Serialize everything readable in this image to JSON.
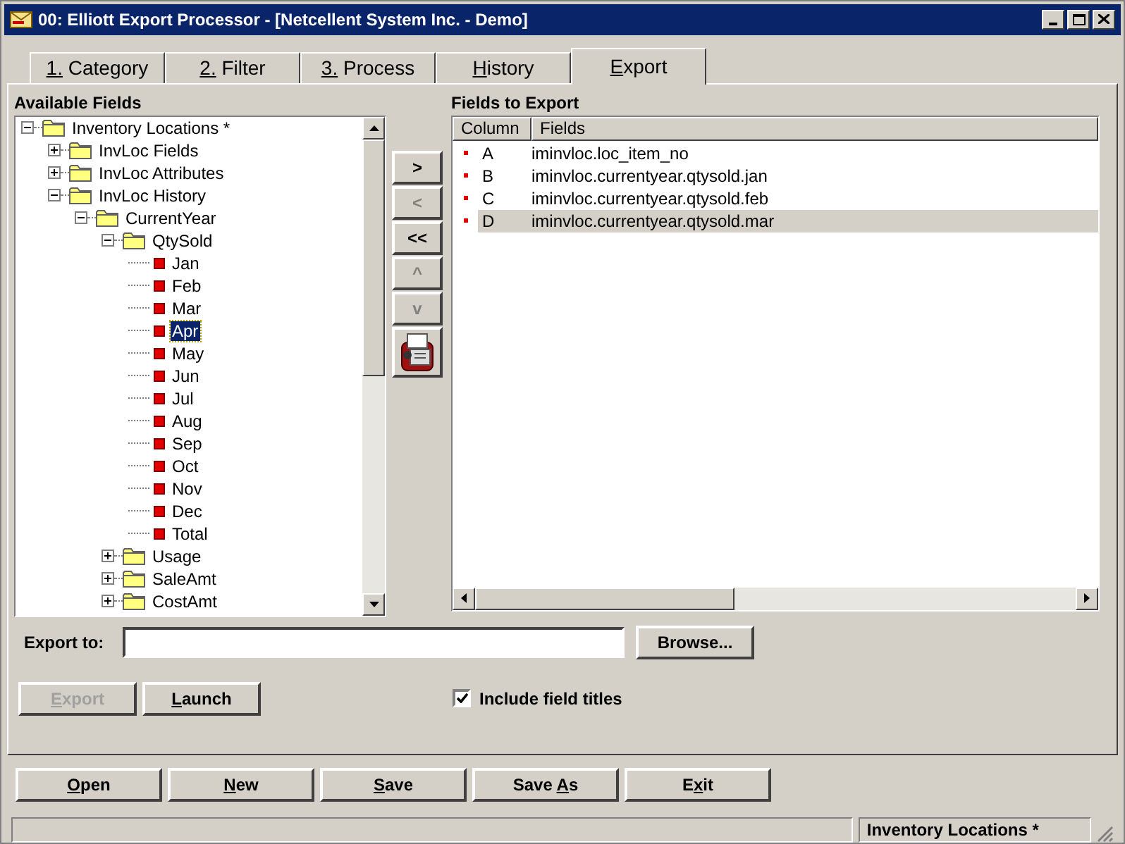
{
  "window": {
    "title": "00: Elliott Export Processor - [Netcellent System Inc. - Demo]"
  },
  "tabs": [
    {
      "key": "1.",
      "post": " Category",
      "selected": false
    },
    {
      "key": "2.",
      "post": " Filter",
      "selected": false
    },
    {
      "key": "3.",
      "post": " Process",
      "selected": false
    },
    {
      "key": "H",
      "post": "istory",
      "selected": false
    },
    {
      "key": "E",
      "post": "xport",
      "selected": true
    }
  ],
  "available_fields": {
    "title": "Available Fields",
    "tree": [
      {
        "kind": "folder",
        "label": "Inventory Locations *",
        "expanded": true,
        "selected": false,
        "children": [
          {
            "kind": "folder",
            "label": "InvLoc Fields",
            "expanded": false,
            "selected": false
          },
          {
            "kind": "folder",
            "label": "InvLoc Attributes",
            "expanded": false,
            "selected": false
          },
          {
            "kind": "folder",
            "label": "InvLoc History",
            "expanded": true,
            "selected": false,
            "children": [
              {
                "kind": "folder",
                "label": "CurrentYear",
                "expanded": true,
                "selected": false,
                "children": [
                  {
                    "kind": "folder",
                    "label": "QtySold",
                    "expanded": true,
                    "selected": false,
                    "children": [
                      {
                        "kind": "field",
                        "label": "Jan",
                        "selected": false
                      },
                      {
                        "kind": "field",
                        "label": "Feb",
                        "selected": false
                      },
                      {
                        "kind": "field",
                        "label": "Mar",
                        "selected": false
                      },
                      {
                        "kind": "field",
                        "label": "Apr",
                        "selected": true
                      },
                      {
                        "kind": "field",
                        "label": "May",
                        "selected": false
                      },
                      {
                        "kind": "field",
                        "label": "Jun",
                        "selected": false
                      },
                      {
                        "kind": "field",
                        "label": "Jul",
                        "selected": false
                      },
                      {
                        "kind": "field",
                        "label": "Aug",
                        "selected": false
                      },
                      {
                        "kind": "field",
                        "label": "Sep",
                        "selected": false
                      },
                      {
                        "kind": "field",
                        "label": "Oct",
                        "selected": false
                      },
                      {
                        "kind": "field",
                        "label": "Nov",
                        "selected": false
                      },
                      {
                        "kind": "field",
                        "label": "Dec",
                        "selected": false
                      },
                      {
                        "kind": "field",
                        "label": "Total",
                        "selected": false
                      }
                    ]
                  },
                  {
                    "kind": "folder",
                    "label": "Usage",
                    "expanded": false,
                    "selected": false
                  },
                  {
                    "kind": "folder",
                    "label": "SaleAmt",
                    "expanded": false,
                    "selected": false
                  },
                  {
                    "kind": "folder",
                    "label": "CostAmt",
                    "expanded": false,
                    "selected": false
                  }
                ]
              }
            ]
          }
        ]
      }
    ]
  },
  "move_buttons": [
    {
      "kind": "text",
      "label": ">",
      "disabled": false
    },
    {
      "kind": "text",
      "label": "<",
      "disabled": true
    },
    {
      "kind": "text",
      "label": "<<",
      "disabled": false
    },
    {
      "kind": "text",
      "label": "^",
      "disabled": true
    },
    {
      "kind": "text",
      "label": "v",
      "disabled": true
    },
    {
      "kind": "icon"
    }
  ],
  "fields_to_export": {
    "title": "Fields to Export",
    "columns": [
      "Column",
      "Fields"
    ],
    "rows": [
      {
        "column": "A",
        "field": "iminvloc.loc_item_no",
        "selected": false
      },
      {
        "column": "B",
        "field": "iminvloc.currentyear.qtysold.jan",
        "selected": false
      },
      {
        "column": "C",
        "field": "iminvloc.currentyear.qtysold.feb",
        "selected": false
      },
      {
        "column": "D",
        "field": "iminvloc.currentyear.qtysold.mar",
        "selected": true
      }
    ]
  },
  "export_to": {
    "label": "Export to:",
    "browse": "Browse..."
  },
  "actions": [
    {
      "key": "E",
      "post": "xport",
      "disabled": true
    },
    {
      "key": "L",
      "post": "aunch",
      "disabled": false
    }
  ],
  "include_field_titles": {
    "label": "Include field titles",
    "checked": true
  },
  "bottom_buttons": [
    {
      "key": "O",
      "post": "pen"
    },
    {
      "key": "N",
      "post": "ew"
    },
    {
      "key": "S",
      "post": "ave"
    },
    {
      "pre": "Save ",
      "key": "A",
      "post": "s"
    },
    {
      "pre": "E",
      "key": "x",
      "post": "it"
    }
  ],
  "status_bar": {
    "panel_2": "Inventory Locations *"
  }
}
